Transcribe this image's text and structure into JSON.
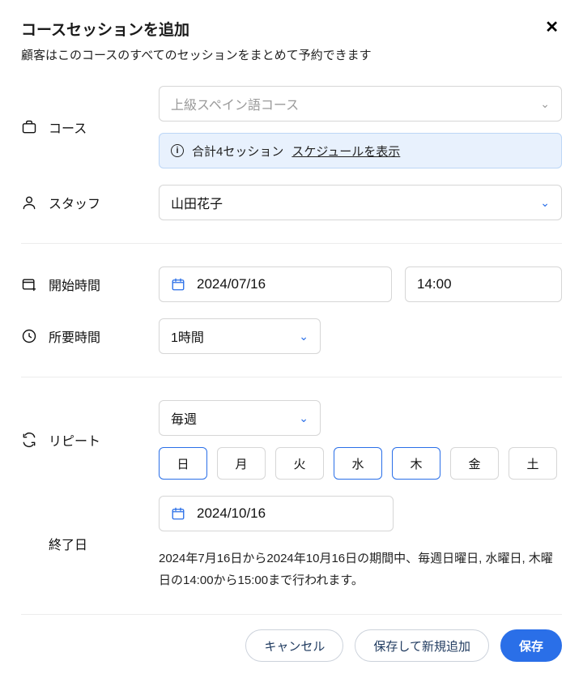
{
  "header": {
    "title": "コースセッションを追加",
    "subtitle": "顧客はこのコースのすべてのセッションをまとめて予約できます",
    "close_icon": "✕"
  },
  "course": {
    "label": "コース",
    "placeholder": "上級スペイン語コース",
    "info_prefix": "合計4セッション",
    "info_link": "スケジュールを表示"
  },
  "staff": {
    "label": "スタッフ",
    "value": "山田花子"
  },
  "start": {
    "label": "開始時間",
    "date": "2024/07/16",
    "time": "14:00"
  },
  "duration": {
    "label": "所要時間",
    "value": "1時間"
  },
  "repeat": {
    "label": "リピート",
    "value": "毎週",
    "days": [
      {
        "short": "日",
        "selected": true
      },
      {
        "short": "月",
        "selected": false
      },
      {
        "short": "火",
        "selected": false
      },
      {
        "short": "水",
        "selected": true
      },
      {
        "short": "木",
        "selected": true
      },
      {
        "short": "金",
        "selected": false
      },
      {
        "short": "土",
        "selected": false
      }
    ],
    "end_label": "終了日",
    "end_date": "2024/10/16",
    "description": "2024年7月16日から2024年10月16日の期間中、毎週日曜日, 水曜日, 木曜日の14:00から15:00まで行われます。"
  },
  "footer": {
    "cancel": "キャンセル",
    "save_add": "保存して新規追加",
    "save": "保存"
  }
}
